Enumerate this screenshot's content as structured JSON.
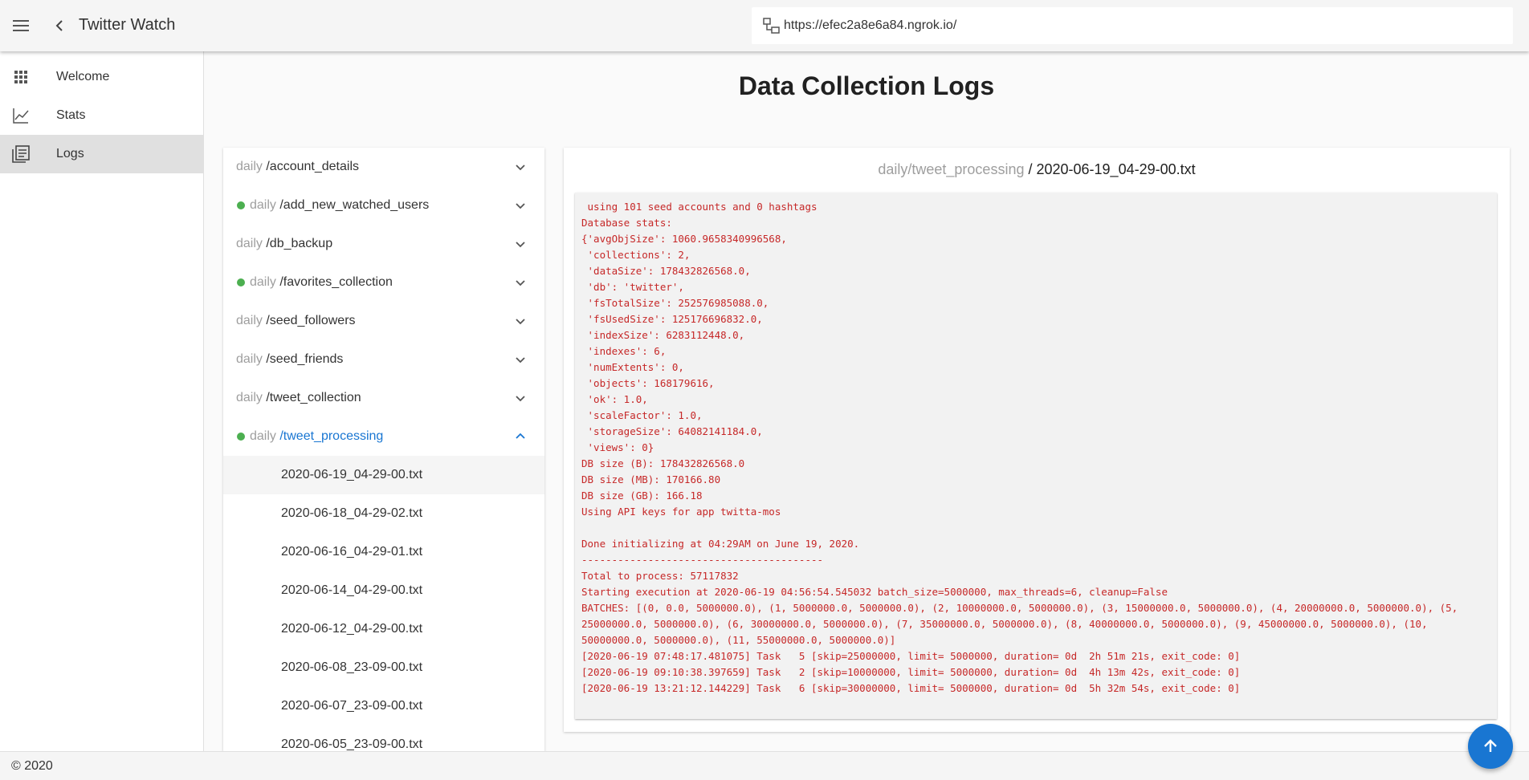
{
  "app": {
    "title": "Twitter Watch",
    "url": "https://efec2a8e6a84.ngrok.io/"
  },
  "sidebar": {
    "items": [
      {
        "label": "Welcome",
        "icon": "grid-icon"
      },
      {
        "label": "Stats",
        "icon": "line-chart-icon"
      },
      {
        "label": "Logs",
        "icon": "logs-icon",
        "active": true
      }
    ]
  },
  "page": {
    "title": "Data Collection Logs"
  },
  "tree": {
    "categories": [
      {
        "prefix": "daily",
        "name": "/account_details",
        "status": false
      },
      {
        "prefix": "daily",
        "name": "/add_new_watched_users",
        "status": true
      },
      {
        "prefix": "daily",
        "name": "/db_backup",
        "status": false
      },
      {
        "prefix": "daily",
        "name": "/favorites_collection",
        "status": true
      },
      {
        "prefix": "daily",
        "name": "/seed_followers",
        "status": false
      },
      {
        "prefix": "daily",
        "name": "/seed_friends",
        "status": false
      },
      {
        "prefix": "daily",
        "name": "/tweet_collection",
        "status": false
      },
      {
        "prefix": "daily",
        "name": "/tweet_processing",
        "status": true,
        "expanded": true
      }
    ],
    "files": [
      "2020-06-19_04-29-00.txt",
      "2020-06-18_04-29-02.txt",
      "2020-06-16_04-29-01.txt",
      "2020-06-14_04-29-00.txt",
      "2020-06-12_04-29-00.txt",
      "2020-06-08_23-09-00.txt",
      "2020-06-07_23-09-00.txt",
      "2020-06-05_23-09-00.txt"
    ]
  },
  "log": {
    "path_prefix": "daily/tweet_processing",
    "separator": " / ",
    "file": "2020-06-19_04-29-00.txt",
    "lines": [
      " using 101 seed accounts and 0 hashtags",
      "Database stats:",
      "{'avgObjSize': 1060.9658340996568,",
      " 'collections': 2,",
      " 'dataSize': 178432826568.0,",
      " 'db': 'twitter',",
      " 'fsTotalSize': 252576985088.0,",
      " 'fsUsedSize': 125176696832.0,",
      " 'indexSize': 6283112448.0,",
      " 'indexes': 6,",
      " 'numExtents': 0,",
      " 'objects': 168179616,",
      " 'ok': 1.0,",
      " 'scaleFactor': 1.0,",
      " 'storageSize': 64082141184.0,",
      " 'views': 0}",
      "DB size (B): 178432826568.0",
      "DB size (MB): 170166.80",
      "DB size (GB): 166.18",
      "Using API keys for app twitta-mos",
      "",
      "Done initializing at 04:29AM on June 19, 2020.",
      "----------------------------------------",
      "Total to process: 57117832",
      "Starting execution at 2020-06-19 04:56:54.545032 batch_size=5000000, max_threads=6, cleanup=False",
      "BATCHES: [(0, 0.0, 5000000.0), (1, 5000000.0, 5000000.0), (2, 10000000.0, 5000000.0), (3, 15000000.0, 5000000.0), (4, 20000000.0, 5000000.0), (5,",
      "25000000.0, 5000000.0), (6, 30000000.0, 5000000.0), (7, 35000000.0, 5000000.0), (8, 40000000.0, 5000000.0), (9, 45000000.0, 5000000.0), (10,",
      "50000000.0, 5000000.0), (11, 55000000.0, 5000000.0)]",
      "[2020-06-19 07:48:17.481075] Task   5 [skip=25000000, limit= 5000000, duration= 0d  2h 51m 21s, exit_code: 0]",
      "[2020-06-19 09:10:38.397659] Task   2 [skip=10000000, limit= 5000000, duration= 0d  4h 13m 42s, exit_code: 0]",
      "[2020-06-19 13:21:12.144229] Task   6 [skip=30000000, limit= 5000000, duration= 0d  5h 32m 54s, exit_code: 0]"
    ]
  },
  "footer": {
    "text": "© 2020"
  },
  "colors": {
    "accent": "#1976d2",
    "status_ok": "#4caf50",
    "log_text": "#c62828"
  }
}
